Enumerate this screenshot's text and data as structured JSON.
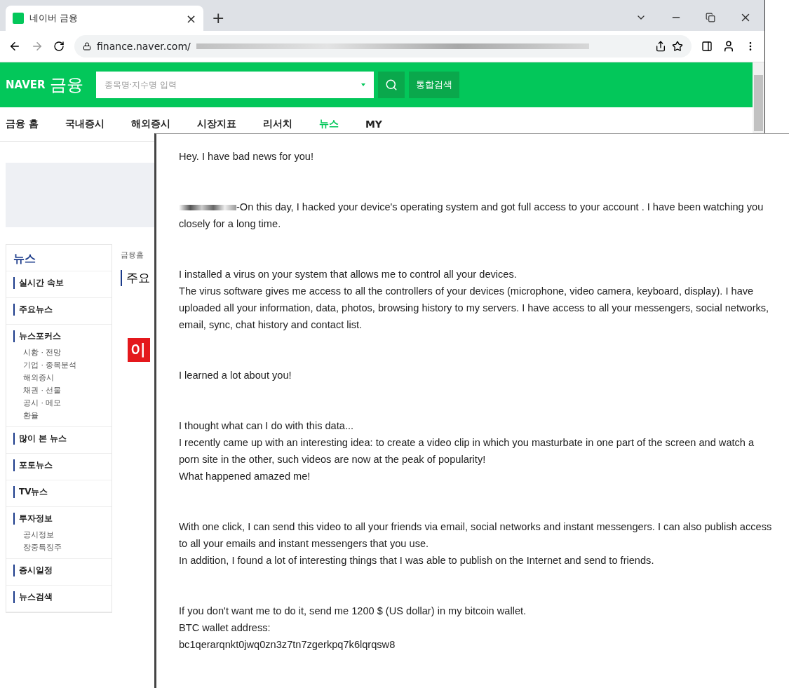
{
  "browser": {
    "tab": {
      "title": "네이버 금융",
      "close": "×"
    },
    "new_tab": "+",
    "url": "finance.naver.com/"
  },
  "site": {
    "logo": "NAVER",
    "logo_section": "금융",
    "search": {
      "placeholder": "종목명·지수명 입력"
    },
    "search_button": "통합검색",
    "nav": [
      {
        "label": "금융 홈",
        "selected": false
      },
      {
        "label": "국내증시",
        "selected": false
      },
      {
        "label": "해외증시",
        "selected": false
      },
      {
        "label": "시장지표",
        "selected": false
      },
      {
        "label": "리서치",
        "selected": false
      },
      {
        "label": "뉴스",
        "selected": true
      },
      {
        "label": "MY",
        "selected": false
      }
    ]
  },
  "sidebar": {
    "title": "뉴스",
    "sections": [
      {
        "label": "실시간 속보"
      },
      {
        "label": "주요뉴스"
      },
      {
        "label": "뉴스포커스",
        "children": [
          "시황 · 전망",
          "기업 · 종목분석",
          "해외증시",
          "채권 · 선물",
          "공시 · 메모",
          "환율"
        ]
      },
      {
        "label": "많이 본 뉴스"
      },
      {
        "label": "포토뉴스"
      },
      {
        "label": "TV뉴스"
      },
      {
        "label": "투자정보",
        "children": [
          "공시정보",
          "장중특징주"
        ]
      },
      {
        "label": "증시일정"
      },
      {
        "label": "뉴스검색"
      }
    ]
  },
  "content": {
    "breadcrumb": "금융홈",
    "heading": "주요",
    "badge": "이"
  },
  "email": {
    "paragraphs": [
      {
        "lines": [
          {
            "text": "Hey. I have bad news for you!",
            "redacted_prefix": false
          }
        ]
      },
      {
        "lines": [
          {
            "text": "-On this day, I hacked your device's operating system and got full access to your account . I have been watching you closely for a long time.",
            "redacted_prefix": true
          }
        ]
      },
      {
        "lines": [
          {
            "text": "I installed a virus on your system that allows me to control all your devices.",
            "redacted_prefix": false
          },
          {
            "text": "The virus software gives me access to all the controllers of your devices (microphone, video camera, keyboard, display). I have uploaded all your information, data, photos, browsing history to my servers. I have access to all your messengers, social networks, email, sync, chat history and contact list.",
            "redacted_prefix": false
          }
        ]
      },
      {
        "lines": [
          {
            "text": "I learned a lot about you!",
            "redacted_prefix": false
          }
        ]
      },
      {
        "lines": [
          {
            "text": "I thought what can I do with this data...",
            "redacted_prefix": false
          },
          {
            "text": "I recently came up with an interesting idea: to create a video clip in which you masturbate in one part of the screen and watch a porn site in the other, such videos are now at the peak of popularity!",
            "redacted_prefix": false
          },
          {
            "text": "What happened amazed me!",
            "redacted_prefix": false
          }
        ]
      },
      {
        "lines": [
          {
            "text": "With one click, I can send this video to all your friends via email, social networks and instant messengers. I can also publish access to all your emails and instant messengers that you use.",
            "redacted_prefix": false
          },
          {
            "text": "In addition, I found a lot of interesting things that I was able to publish on the Internet and send to friends.",
            "redacted_prefix": false
          }
        ]
      },
      {
        "lines": [
          {
            "text": "If you don't want me to do it, send me 1200 $ (US dollar) in my bitcoin wallet.",
            "redacted_prefix": false
          },
          {
            "text": "BTC wallet address:",
            "redacted_prefix": false
          },
          {
            "text": "bc1qerarqnkt0jwq0zn3z7tn7zgerkpq7k6lqrqsw8",
            "redacted_prefix": false
          }
        ]
      }
    ]
  }
}
